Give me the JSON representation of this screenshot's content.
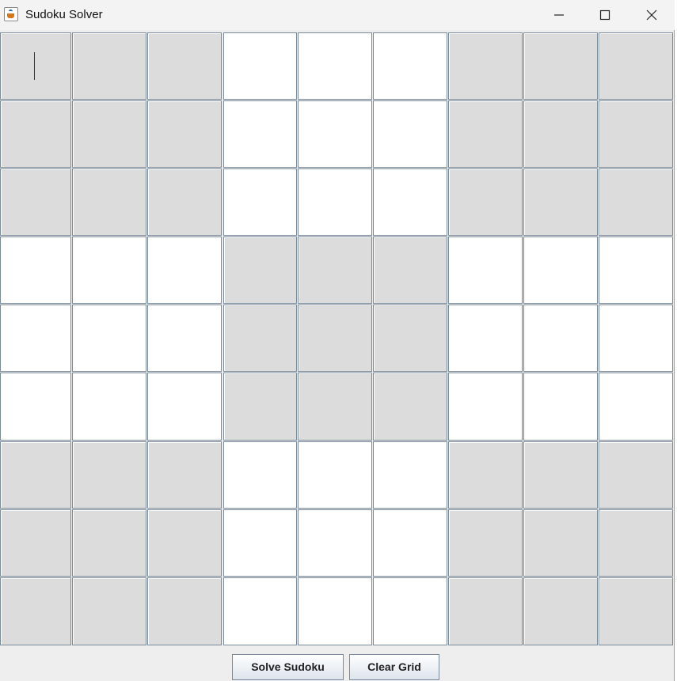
{
  "window": {
    "title": "Sudoku Solver"
  },
  "grid": {
    "rows": 9,
    "cols": 9,
    "cells": [
      [
        "",
        "",
        "",
        "",
        "",
        "",
        "",
        "",
        ""
      ],
      [
        "",
        "",
        "",
        "",
        "",
        "",
        "",
        "",
        ""
      ],
      [
        "",
        "",
        "",
        "",
        "",
        "",
        "",
        "",
        ""
      ],
      [
        "",
        "",
        "",
        "",
        "",
        "",
        "",
        "",
        ""
      ],
      [
        "",
        "",
        "",
        "",
        "",
        "",
        "",
        "",
        ""
      ],
      [
        "",
        "",
        "",
        "",
        "",
        "",
        "",
        "",
        ""
      ],
      [
        "",
        "",
        "",
        "",
        "",
        "",
        "",
        "",
        ""
      ],
      [
        "",
        "",
        "",
        "",
        "",
        "",
        "",
        "",
        ""
      ],
      [
        "",
        "",
        "",
        "",
        "",
        "",
        "",
        "",
        ""
      ]
    ],
    "focused_cell": [
      0,
      0
    ],
    "shaded_box_color": "#dcdcdc",
    "plain_box_color": "#ffffff"
  },
  "buttons": {
    "solve_label": "Solve Sudoku",
    "clear_label": "Clear Grid"
  }
}
